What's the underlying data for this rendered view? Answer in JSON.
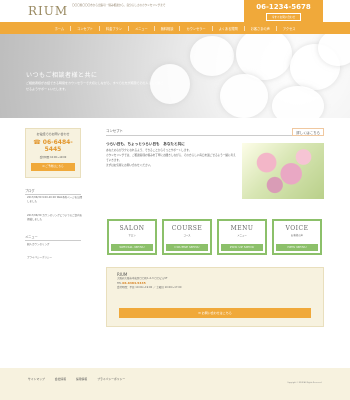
{
  "header": {
    "logo": "RIUM",
    "tagline": "〇〇〇県〇〇〇市から出張可・悩み相談から、自分らしさのカウンセリングまで",
    "phone": "06-1234-5678",
    "contact_button": "今すぐお問い合わせ"
  },
  "nav": {
    "items": [
      "ホーム",
      "コンセプト",
      "料金プラン",
      "メニュー",
      "無料相談",
      "カウンセラー",
      "よくある質問",
      "お客さまの声",
      "アクセス"
    ]
  },
  "hero": {
    "title": "いつもご相談者様と共に",
    "text": "ご相談者様がお話できる時間をカウンセラーで大切にしながら、すべての方が笑顔でその人らしく過ごせるようサポートいたします。"
  },
  "sidebar": {
    "tel_caption": "お電話でのお問い合わせ",
    "tel_number": "06-6484-5445",
    "tel_hours": "受付時間 10:00〜19:00",
    "mail_button": "ご予約はこちら",
    "news_heading": "ブログ",
    "news_items": [
      "2017/06/30 9:00-20:00 Web予約ページを公開しました",
      "2017/06/30 カウンセリングについてのご案内を掲載しました"
    ],
    "menu_heading": "メニュー",
    "menu_items": [
      "個人カウンセリング"
    ],
    "footer_link": "プライバシーポリシー"
  },
  "concept": {
    "heading": "コンセプト",
    "more": "詳しくはこちら",
    "lead": "つらい日も、ちょっとつらい日も　あなたと共に",
    "paragraphs": [
      "あなたの心がラクになれるよう、できることからそっとサポートします。",
      "カウンセリングでは、ご相談者様の悩みを丁寧にお聞きしながら、その方らしい毎日を過ごせるよう一緒に考えていきます。",
      "まずはお気軽にお問い合わせください。"
    ]
  },
  "cards": [
    {
      "title": "SALON",
      "sub": "サロン",
      "button": "SPECIAL MENU"
    },
    {
      "title": "COURSE",
      "sub": "コース",
      "button": "COURSE MENU"
    },
    {
      "title": "MENU",
      "sub": "メニュー",
      "button": "PICK UP MENU"
    },
    {
      "title": "VOICE",
      "sub": "お客様の声",
      "button": "NEW MENU"
    }
  ],
  "info": {
    "name": "RIUM",
    "address": "大阪府大阪市中央区〇〇町1-2-3 〇〇ビル5F",
    "phone_label": "TEL",
    "phone": "06-6484-5445",
    "hours": "受付時間：平日 10:00〜19:00 ／ 土曜日 10:00〜17:00",
    "button": "お問い合わせはこちら"
  },
  "footer": {
    "links": [
      "サイトマップ",
      "会社情報",
      "採用情報",
      "プライバシーポリシー"
    ],
    "copyright": "Copyright © RIUM All Rights Reserved."
  },
  "colors": {
    "accent": "#f0a93a",
    "card_border": "#8cc06a",
    "panel_bg": "#f7f2df"
  }
}
